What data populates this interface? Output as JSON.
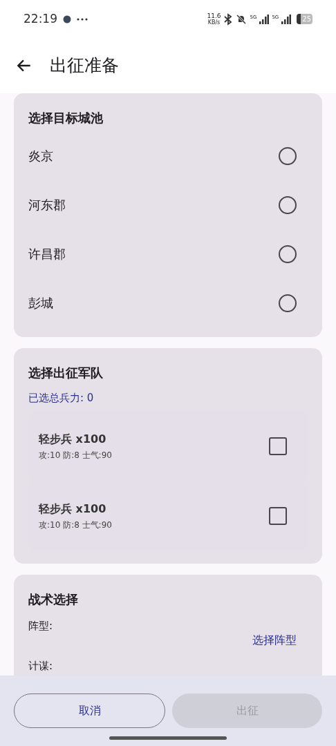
{
  "status_bar": {
    "time": "22:19",
    "net_speed": "11.6",
    "net_unit": "KB/s",
    "sim1": "5G",
    "sim2": "5G",
    "battery": "25"
  },
  "app_bar": {
    "title": "出征准备"
  },
  "city_card": {
    "title": "选择目标城池",
    "options": [
      {
        "label": "炎京",
        "selected": false
      },
      {
        "label": "河东郡",
        "selected": false
      },
      {
        "label": "许昌郡",
        "selected": false
      },
      {
        "label": "彭城",
        "selected": false
      }
    ]
  },
  "army_card": {
    "title": "选择出征军队",
    "total": "已选总兵力: 0",
    "units": [
      {
        "name": "轻步兵 x100",
        "stats": "攻:10 防:8 士气:90",
        "checked": false
      },
      {
        "name": "轻步兵 x100",
        "stats": "攻:10 防:8 士气:90",
        "checked": false
      }
    ]
  },
  "tactics_card": {
    "title": "战术选择",
    "formation_label": "阵型:",
    "formation_button": "选择阵型",
    "strategy_label": "计谋:"
  },
  "actions": [
    {
      "label": "取消",
      "disabled": false,
      "kind": "outlined"
    },
    {
      "label": "出征",
      "disabled": true,
      "kind": "filled"
    }
  ]
}
